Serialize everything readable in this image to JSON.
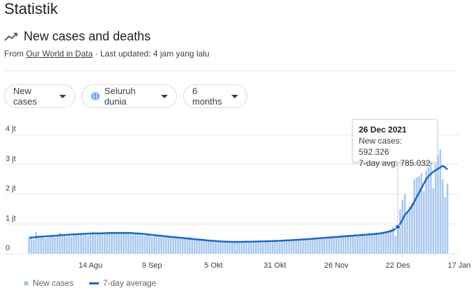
{
  "page": {
    "title": "Statistik",
    "subtitle": "New cases and deaths",
    "source_prefix": "From ",
    "source_link": "Our World in Data",
    "source_suffix": " · Last updated: 4 jam yang lalu"
  },
  "filters": {
    "metric": "New cases",
    "region": "Seluruh dunia",
    "period": "6 months"
  },
  "tooltip": {
    "date": "26 Dec 2021",
    "new_cases": "New cases: 592.326",
    "avg": "7-day avg: 785.032"
  },
  "legend": {
    "bars": "New cases",
    "line": "7-day average"
  },
  "colors": {
    "bar": "#a7c7f1",
    "line": "#1a66c5",
    "grid": "#e8eaed"
  },
  "chart_data": {
    "type": "bar",
    "ylabel": "",
    "xlabel": "",
    "ylim": [
      0,
      4000000
    ],
    "y_ticks": [
      "0",
      "1 jt",
      "2 jt",
      "3 jt",
      "4 jt"
    ],
    "y_tick_values": [
      0,
      1000000,
      2000000,
      3000000,
      4000000
    ],
    "x_ticks": [
      "14 Agu",
      "9 Sep",
      "5 Okt",
      "31 Okt",
      "26 Nov",
      "22 Des",
      "17 Jan"
    ],
    "x_tick_index": [
      26,
      52,
      78,
      104,
      130,
      156,
      182
    ],
    "series": [
      {
        "name": "New cases",
        "kind": "bar",
        "values": [
          520000,
          540000,
          480000,
          720000,
          560000,
          590000,
          600000,
          520000,
          610000,
          580000,
          620000,
          560000,
          640000,
          700000,
          600000,
          620000,
          570000,
          600000,
          580000,
          650000,
          670000,
          620000,
          690000,
          640000,
          680000,
          600000,
          700000,
          740000,
          640000,
          690000,
          670000,
          700000,
          660000,
          710000,
          690000,
          740000,
          720000,
          680000,
          700000,
          690000,
          720000,
          710000,
          680000,
          650000,
          700000,
          660000,
          700000,
          640000,
          620000,
          600000,
          660000,
          640000,
          570000,
          620000,
          640000,
          580000,
          600000,
          560000,
          600000,
          560000,
          540000,
          580000,
          520000,
          560000,
          540000,
          500000,
          540000,
          500000,
          560000,
          530000,
          470000,
          510000,
          470000,
          500000,
          480000,
          440000,
          460000,
          420000,
          450000,
          400000,
          440000,
          420000,
          380000,
          420000,
          400000,
          380000,
          410000,
          390000,
          420000,
          360000,
          400000,
          380000,
          420000,
          390000,
          370000,
          410000,
          380000,
          400000,
          420000,
          360000,
          420000,
          400000,
          390000,
          430000,
          410000,
          440000,
          400000,
          420000,
          450000,
          430000,
          470000,
          420000,
          460000,
          440000,
          480000,
          430000,
          460000,
          500000,
          480000,
          460000,
          500000,
          520000,
          480000,
          510000,
          530000,
          500000,
          540000,
          520000,
          560000,
          530000,
          560000,
          600000,
          620000,
          560000,
          600000,
          640000,
          590000,
          630000,
          660000,
          600000,
          650000,
          680000,
          620000,
          660000,
          700000,
          640000,
          680000,
          720000,
          660000,
          700000,
          740000,
          700000,
          780000,
          820000,
          900000,
          592326,
          1000000,
          1500000,
          1800000,
          2000000,
          1400000,
          1600000,
          1700000,
          2500000,
          2550000,
          2600000,
          2700000,
          2100000,
          2800000,
          2900000,
          3200000,
          2200000,
          3000000,
          3300000,
          3500000,
          2500000,
          1900000,
          2350000
        ],
        "note_index_of_tooltip": 156
      },
      {
        "name": "7-day average",
        "kind": "line",
        "values": [
          540000,
          545000,
          550000,
          560000,
          570000,
          575000,
          580000,
          585000,
          590000,
          595000,
          600000,
          605000,
          610000,
          620000,
          625000,
          630000,
          635000,
          640000,
          645000,
          650000,
          655000,
          660000,
          665000,
          670000,
          672000,
          675000,
          678000,
          680000,
          682000,
          684000,
          686000,
          688000,
          690000,
          692000,
          694000,
          696000,
          698000,
          699000,
          700000,
          700000,
          700000,
          699000,
          698000,
          695000,
          690000,
          685000,
          680000,
          675000,
          670000,
          660000,
          650000,
          640000,
          632000,
          624000,
          616000,
          608000,
          600000,
          592000,
          584000,
          576000,
          568000,
          560000,
          552000,
          545000,
          538000,
          530000,
          522000,
          514000,
          506000,
          498000,
          490000,
          482000,
          475000,
          468000,
          460000,
          452000,
          445000,
          438000,
          432000,
          426000,
          420000,
          415000,
          410000,
          406000,
          402000,
          400000,
          398000,
          397000,
          397000,
          398000,
          399000,
          400000,
          402000,
          404000,
          406000,
          408000,
          410000,
          412000,
          414000,
          416000,
          418000,
          420000,
          423000,
          426000,
          429000,
          432000,
          436000,
          440000,
          444000,
          448000,
          452000,
          456000,
          461000,
          466000,
          471000,
          476000,
          481000,
          486000,
          492000,
          498000,
          504000,
          510000,
          516000,
          522000,
          528000,
          534000,
          540000,
          546000,
          552000,
          558000,
          564000,
          570000,
          576000,
          582000,
          588000,
          594000,
          600000,
          606000,
          612000,
          618000,
          624000,
          630000,
          636000,
          642000,
          648000,
          654000,
          660000,
          668000,
          676000,
          690000,
          705000,
          720000,
          740000,
          760000,
          785032,
          830000,
          900000,
          1000000,
          1150000,
          1300000,
          1400000,
          1480000,
          1600000,
          1750000,
          1900000,
          2050000,
          2200000,
          2350000,
          2500000,
          2600000,
          2680000,
          2750000,
          2800000,
          2850000,
          2900000,
          2950000,
          2900000,
          2830000
        ]
      }
    ],
    "grid": true,
    "legend_position": "bottom-left"
  }
}
